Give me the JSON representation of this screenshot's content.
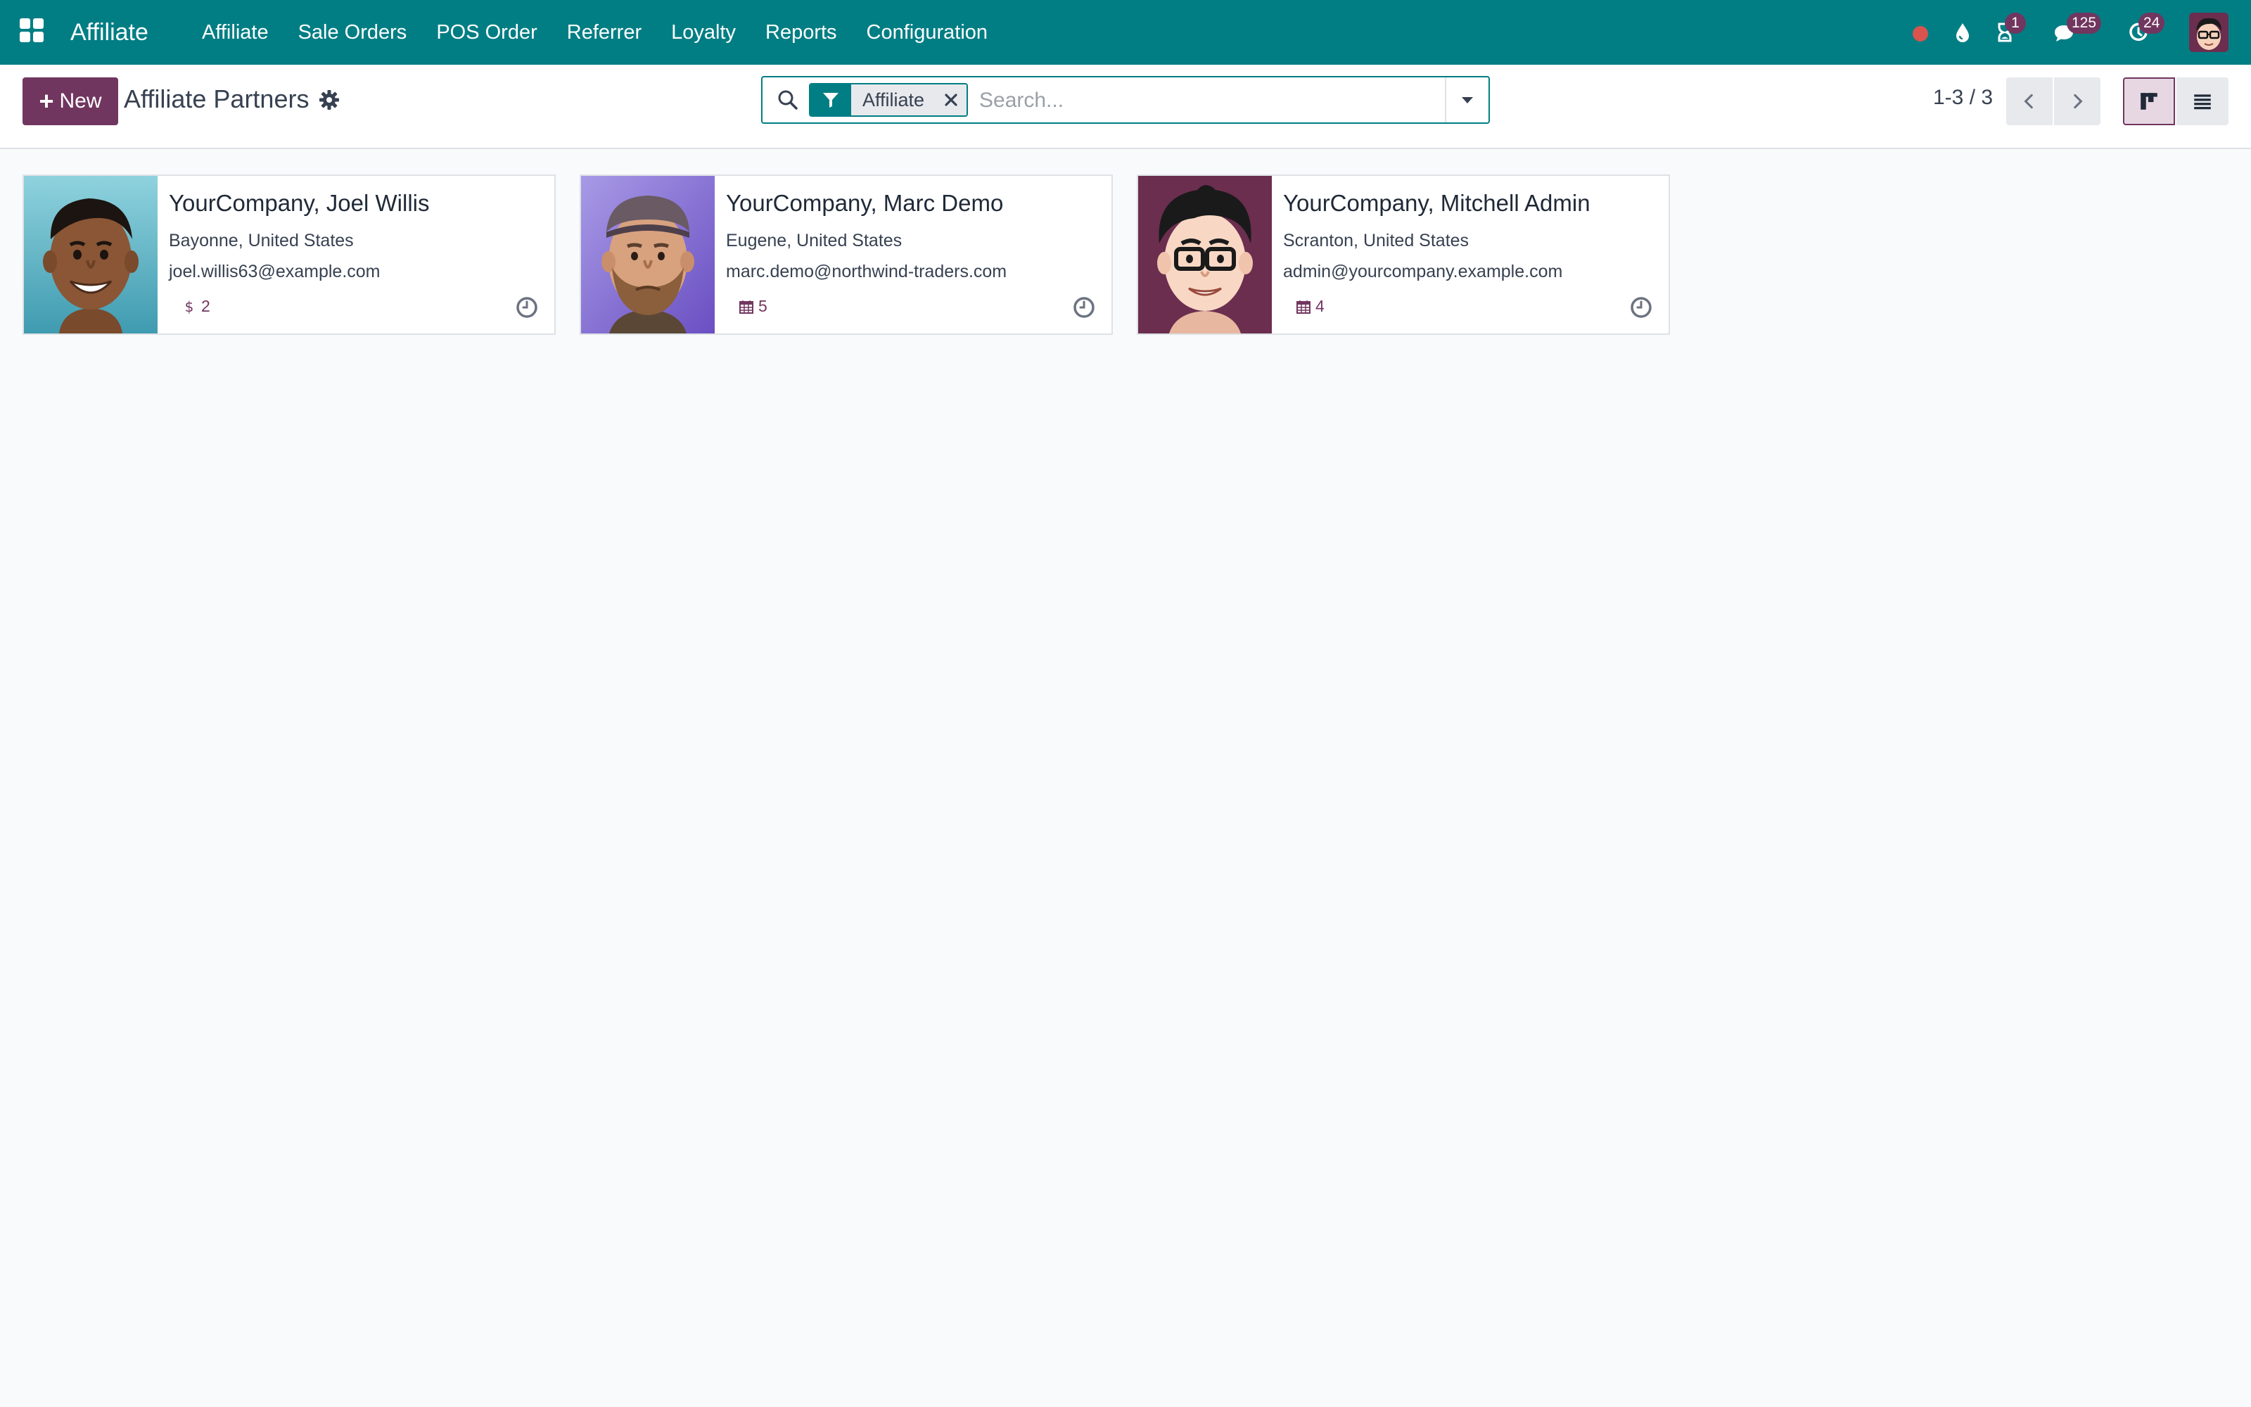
{
  "app": {
    "name": "Affiliate"
  },
  "menu": [
    {
      "label": "Affiliate"
    },
    {
      "label": "Sale Orders"
    },
    {
      "label": "POS Order"
    },
    {
      "label": "Referrer"
    },
    {
      "label": "Loyalty"
    },
    {
      "label": "Reports"
    },
    {
      "label": "Configuration"
    }
  ],
  "systray": {
    "status_color": "#d9534f",
    "activity_count": "1",
    "messages_count": "125",
    "timers_count": "24"
  },
  "control": {
    "new_label": "New",
    "title": "Affiliate Partners",
    "search": {
      "facet_value": "Affiliate",
      "placeholder": "Search..."
    },
    "pager": {
      "value": "1-3 / 3"
    }
  },
  "cards": [
    {
      "name": "YourCompany, Joel Willis",
      "location": "Bayonne, United States",
      "email": "joel.willis63@example.com",
      "stat_icon": "dollar-icon",
      "stat_value": "2"
    },
    {
      "name": "YourCompany, Marc Demo",
      "location": "Eugene, United States",
      "email": "marc.demo@northwind-traders.com",
      "stat_icon": "calendar-icon",
      "stat_value": "5"
    },
    {
      "name": "YourCompany, Mitchell Admin",
      "location": "Scranton, United States",
      "email": "admin@yourcompany.example.com",
      "stat_icon": "calendar-icon",
      "stat_value": "4"
    }
  ],
  "colors": {
    "navbar": "#017e84",
    "primary": "#71365f",
    "background": "#f9fafb"
  }
}
